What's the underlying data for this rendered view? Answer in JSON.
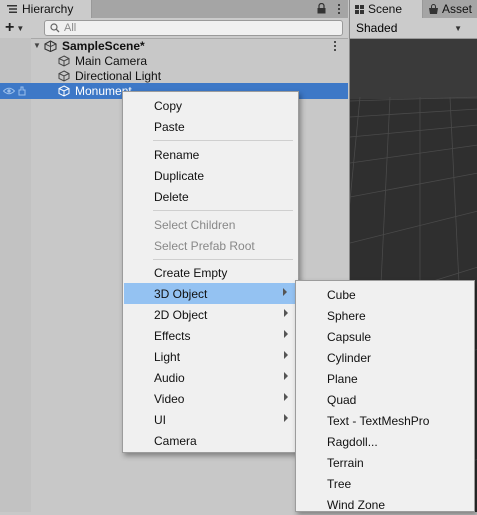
{
  "hierarchy": {
    "tab_label": "Hierarchy",
    "search_placeholder": "All",
    "scene_name": "SampleScene*",
    "items": [
      {
        "label": "Main Camera"
      },
      {
        "label": "Directional Light"
      },
      {
        "label": "Monument"
      }
    ]
  },
  "scene_panel": {
    "tab_scene": "Scene",
    "tab_assets": "Asset",
    "shading_mode": "Shaded"
  },
  "context_menu": {
    "items": [
      {
        "label": "Copy"
      },
      {
        "label": "Paste"
      },
      {
        "label": "Rename"
      },
      {
        "label": "Duplicate"
      },
      {
        "label": "Delete"
      },
      {
        "label": "Select Children"
      },
      {
        "label": "Select Prefab Root"
      },
      {
        "label": "Create Empty"
      },
      {
        "label": "3D Object"
      },
      {
        "label": "2D Object"
      },
      {
        "label": "Effects"
      },
      {
        "label": "Light"
      },
      {
        "label": "Audio"
      },
      {
        "label": "Video"
      },
      {
        "label": "UI"
      },
      {
        "label": "Camera"
      }
    ]
  },
  "submenu_3d": {
    "items": [
      {
        "label": "Cube"
      },
      {
        "label": "Sphere"
      },
      {
        "label": "Capsule"
      },
      {
        "label": "Cylinder"
      },
      {
        "label": "Plane"
      },
      {
        "label": "Quad"
      },
      {
        "label": "Text - TextMeshPro"
      },
      {
        "label": "Ragdoll..."
      },
      {
        "label": "Terrain"
      },
      {
        "label": "Tree"
      },
      {
        "label": "Wind Zone"
      }
    ]
  },
  "colors": {
    "selection": "#3d78c7",
    "menu_highlight": "#94c2f2",
    "scene_background": "#2f2f2f"
  }
}
